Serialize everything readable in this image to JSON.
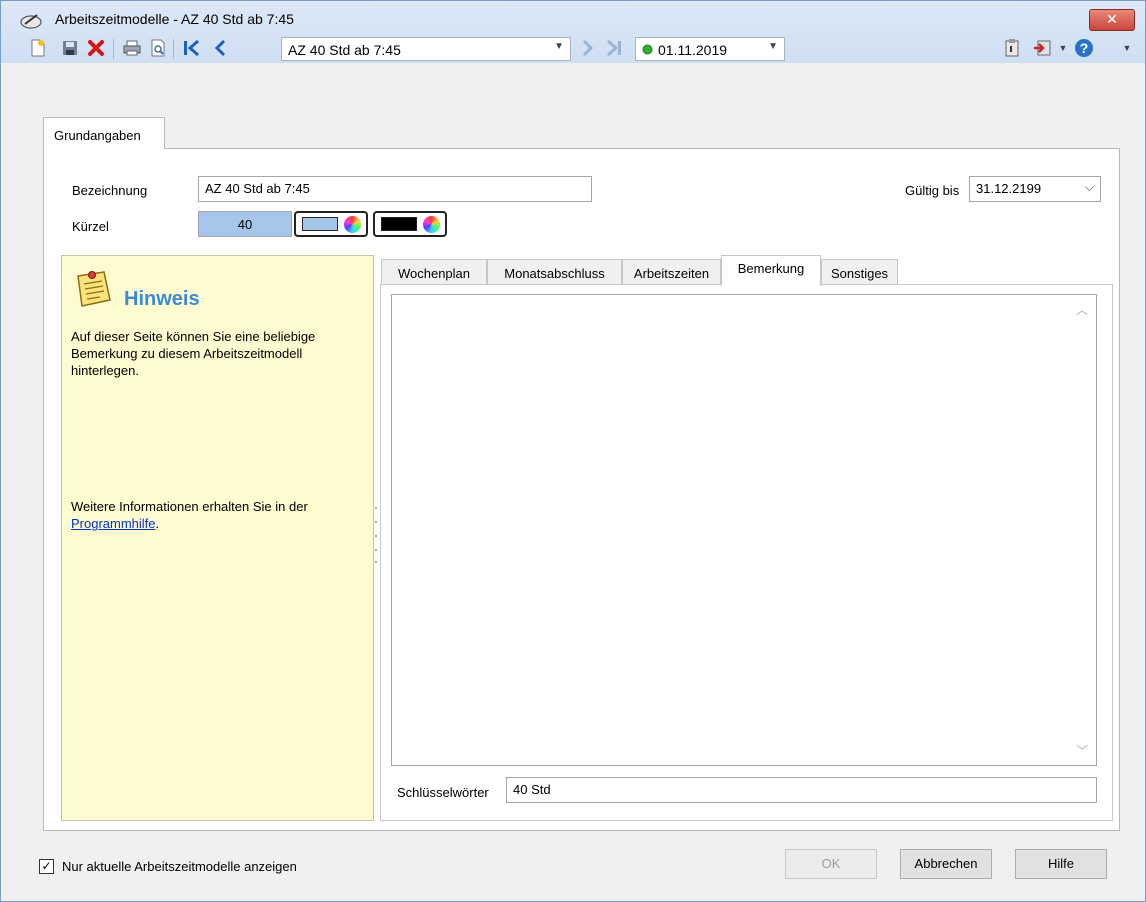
{
  "window": {
    "title": "Arbeitszeitmodelle - AZ 40 Std ab 7:45",
    "close_label": "✕"
  },
  "toolbar": {
    "record_combo_value": "AZ 40 Std ab 7:45",
    "date_combo_value": "01.11.2019",
    "date_status_color": "#2fb12f"
  },
  "outer_tab": {
    "label": "Grundangaben"
  },
  "form": {
    "bezeichnung_label": "Bezeichnung",
    "bezeichnung_value": "AZ 40 Std ab 7:45",
    "kuerzel_label": "Kürzel",
    "kuerzel_value": "40",
    "kuerzel_bg_color": "#a7c6ec",
    "foreground_color": "#000000",
    "gueltig_label": "Gültig bis",
    "gueltig_value": "31.12.2199"
  },
  "hint": {
    "title": "Hinweis",
    "text1": "Auf dieser Seite können Sie eine beliebige Bemerkung zu diesem Arbeitszeitmodell hinterlegen.",
    "text2": "Weitere Informationen erhalten Sie in der",
    "link": "Programmhilfe",
    "after_link": "."
  },
  "inner_tabs": [
    {
      "label": "Wochenplan"
    },
    {
      "label": "Monatsabschluss"
    },
    {
      "label": "Arbeitszeiten"
    },
    {
      "label": "Bemerkung"
    },
    {
      "label": "Sonstiges"
    }
  ],
  "active_inner_tab": "Bemerkung",
  "remark": {
    "text": "",
    "keywords_label": "Schlüsselwörter",
    "keywords_value": "40 Std"
  },
  "footer": {
    "checkbox_label": "Nur aktuelle Arbeitszeitmodelle anzeigen",
    "checkbox_checked": true,
    "ok_label": "OK",
    "cancel_label": "Abbrechen",
    "help_label": "Hilfe"
  }
}
